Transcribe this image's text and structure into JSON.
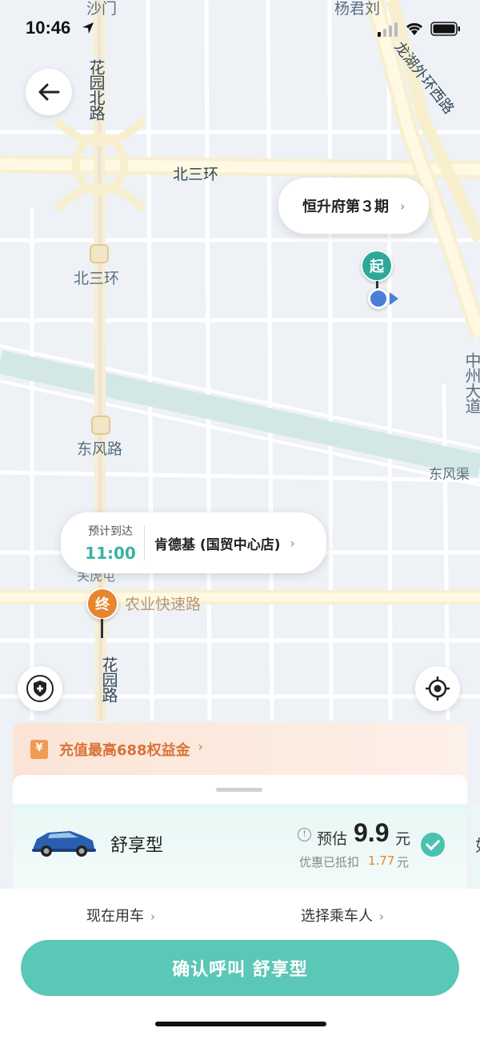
{
  "status_bar": {
    "time": "10:46"
  },
  "map": {
    "labels": {
      "top_left_partial": "沙门",
      "top_right_partial": "杨君刘",
      "longhu_road": "龙湖外环西路",
      "huayuan_north_road": "花园北路",
      "beisanhuan_road": "北三环",
      "beisanhuan_station": "北三环",
      "dongfeng_road_station": "东风路",
      "dongfeng_canal": "东风渠",
      "zhongzhou_avenue": "中州大道",
      "nongye_expressway": "农业快速路",
      "huayuan_road": "花园路",
      "partial_under_bubble": "关虎屯"
    },
    "start_point": {
      "name": "恒升府第３期",
      "pin_label": "起"
    },
    "end_point": {
      "eta_label": "预计到达",
      "eta_time": "11:00",
      "name": "肯德基 (国贸中心店)",
      "pin_label": "终"
    }
  },
  "promo": {
    "text": "充值最高688权益金"
  },
  "ride_option": {
    "name": "舒享型",
    "estimate_label": "预估",
    "price": "9.9",
    "price_unit": "元",
    "discount_label": "优惠已抵扣",
    "discount_amount": "1.77",
    "discount_unit": "元",
    "selected": true,
    "next_option_partial": "如"
  },
  "options": {
    "time_option": "现在用车",
    "passenger_option": "选择乘车人"
  },
  "confirm_button": {
    "label": "确认呼叫  舒享型"
  },
  "colors": {
    "accent": "#5bc7b7",
    "start_pin": "#2fa89a",
    "end_pin": "#e8852f",
    "promo_text": "#d8733a"
  },
  "icons": {
    "back": "arrow-left-icon",
    "safety": "shield-plus-icon",
    "locate": "crosshair-icon",
    "promo": "red-packet-icon",
    "info": "info-icon",
    "check": "check-circle-icon"
  }
}
